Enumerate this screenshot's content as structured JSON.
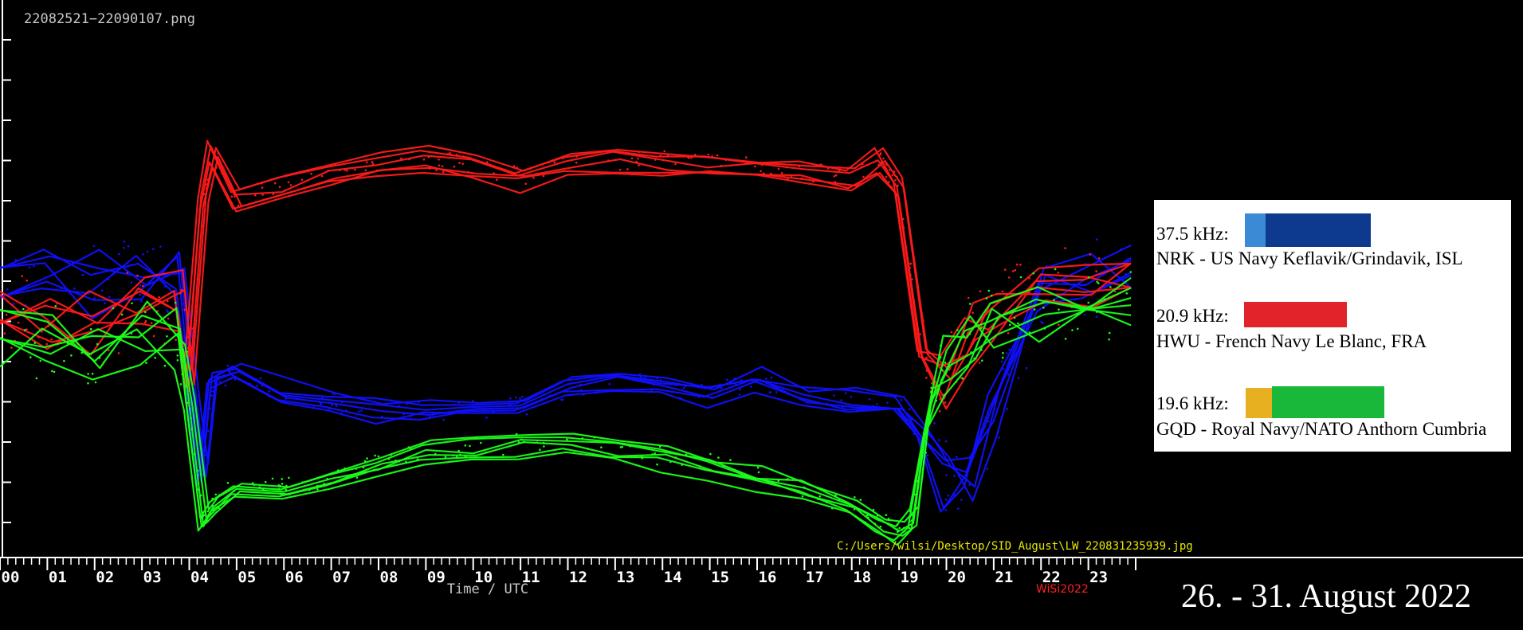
{
  "file_label": "22082521−22090107.png",
  "path_label": "C:/Users/wilsi/Desktop/SID_August\\LW_220831235939.jpg",
  "signature": "WiSi2022",
  "date_label": "26. - 31. August 2022",
  "colors": {
    "background": "#000000",
    "axis": "#ffffff",
    "path_text": "#e8e800",
    "signature": "#ff2020",
    "series_nrk": "#1010ff",
    "series_hwu": "#ff1a1a",
    "series_gqd": "#1aff1a"
  },
  "legend": [
    {
      "freq": "37.5 kHz:",
      "station": "NRK - US Navy Keflavik/Grindavik, ISL",
      "swatch_colors": [
        "#3a8ad6",
        "#0e3a8e"
      ]
    },
    {
      "freq": "20.9 kHz:",
      "station": "HWU - French Navy Le Blanc, FRA",
      "swatch_colors": [
        "#e0242a"
      ]
    },
    {
      "freq": "19.6 kHz:",
      "station": "GQD - Royal Navy/NATO Anthorn Cumbria",
      "swatch_colors": [
        "#e6b020",
        "#19b83a"
      ]
    }
  ],
  "chart_data": {
    "type": "line",
    "xlabel": "Time  /  UTC",
    "xlim": [
      0,
      24
    ],
    "x_ticks": [
      "00",
      "01",
      "02",
      "03",
      "04",
      "05",
      "06",
      "07",
      "08",
      "09",
      "10",
      "11",
      "12",
      "13",
      "14",
      "15",
      "16",
      "17",
      "18",
      "19",
      "20",
      "21",
      "22",
      "23"
    ],
    "ylabel": "",
    "grid": false,
    "series": [
      {
        "name": "NRK",
        "color": "#1010ff",
        "x": [
          0,
          1,
          2,
          3,
          3.8,
          4.1,
          4.3,
          4.5,
          5,
          6,
          7,
          8,
          9,
          10,
          11,
          12,
          13,
          14,
          15,
          16,
          17,
          18,
          19,
          19.5,
          20,
          20.5,
          21,
          22,
          23,
          23.9
        ],
        "y": [
          0.62,
          0.63,
          0.62,
          0.64,
          0.65,
          0.33,
          0.15,
          0.38,
          0.41,
          0.35,
          0.33,
          0.31,
          0.31,
          0.31,
          0.32,
          0.36,
          0.38,
          0.37,
          0.35,
          0.38,
          0.34,
          0.33,
          0.32,
          0.25,
          0.14,
          0.12,
          0.3,
          0.6,
          0.63,
          0.66
        ]
      },
      {
        "name": "HWU",
        "color": "#ff1a1a",
        "x": [
          0,
          1,
          2,
          3,
          3.8,
          4,
          4.3,
          4.5,
          5,
          6,
          7,
          8,
          9,
          10,
          11,
          12,
          13,
          14,
          15,
          16,
          17,
          18,
          18.6,
          19,
          19.5,
          20,
          20.5,
          21,
          22,
          23,
          23.9
        ],
        "y": [
          0.55,
          0.54,
          0.52,
          0.56,
          0.57,
          0.38,
          0.82,
          0.94,
          0.83,
          0.85,
          0.89,
          0.91,
          0.92,
          0.91,
          0.88,
          0.92,
          0.92,
          0.92,
          0.91,
          0.9,
          0.89,
          0.88,
          0.92,
          0.85,
          0.45,
          0.38,
          0.5,
          0.55,
          0.62,
          0.6,
          0.63
        ]
      },
      {
        "name": "GQD",
        "color": "#1aff1a",
        "x": [
          0,
          1,
          2,
          3,
          3.8,
          4,
          4.3,
          4.5,
          5,
          6,
          7,
          8,
          9,
          10,
          11,
          12,
          13,
          14,
          15,
          16,
          17,
          18,
          18.6,
          19,
          19.3,
          19.6,
          20,
          20.5,
          21,
          22,
          23,
          23.9
        ],
        "y": [
          0.5,
          0.48,
          0.46,
          0.5,
          0.49,
          0.32,
          0.04,
          0.08,
          0.13,
          0.12,
          0.15,
          0.18,
          0.21,
          0.22,
          0.23,
          0.23,
          0.22,
          0.2,
          0.18,
          0.15,
          0.12,
          0.08,
          0.04,
          0.02,
          0.05,
          0.3,
          0.42,
          0.48,
          0.53,
          0.57,
          0.55,
          0.59
        ]
      }
    ]
  }
}
